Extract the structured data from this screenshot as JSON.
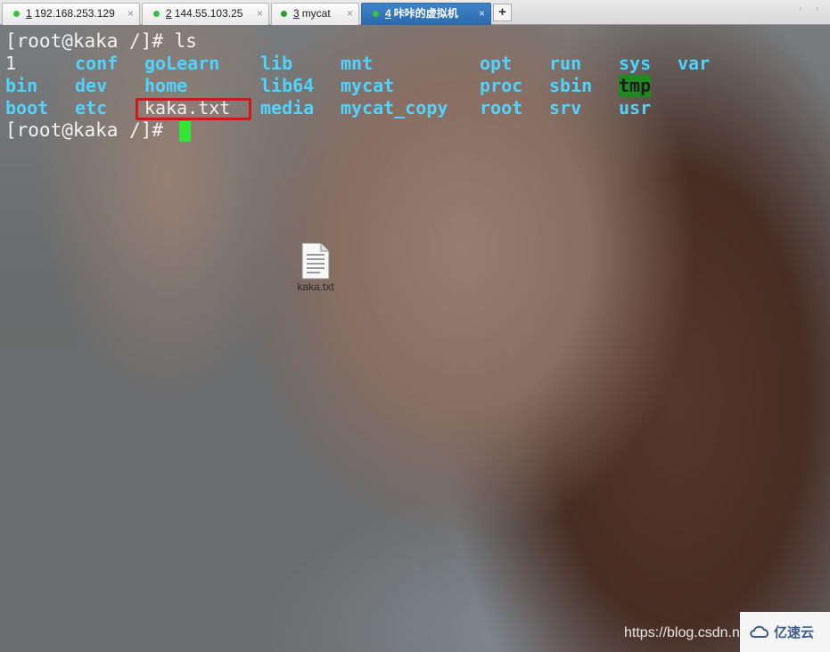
{
  "tabs": [
    {
      "num": "1",
      "label": "192.168.253.129",
      "status_color": "#3cbf3c",
      "active": false
    },
    {
      "num": "2",
      "label": "144.55.103.25",
      "status_color": "#3cbf3c",
      "active": false
    },
    {
      "num": "3",
      "label": "mycat",
      "status_color": "#2e9e2e",
      "active": false
    },
    {
      "num": "4",
      "label": "咔咔的虚拟机",
      "status_color": "#3cbf3c",
      "active": true
    }
  ],
  "tab_close_glyph": "×",
  "add_tab_label": "+",
  "nav_arrows": "‹ ›",
  "terminal": {
    "prompt1": "[root@kaka /]# ls",
    "prompt2": "[root@kaka /]# ",
    "rows": [
      [
        {
          "text": "1",
          "kind": "file"
        },
        {
          "text": "conf",
          "kind": "dir"
        },
        {
          "text": "goLearn",
          "kind": "dir"
        },
        {
          "text": "lib",
          "kind": "dir"
        },
        {
          "text": "mnt",
          "kind": "dir"
        },
        {
          "text": "opt",
          "kind": "dir"
        },
        {
          "text": "run",
          "kind": "dir"
        },
        {
          "text": "sys",
          "kind": "dir"
        },
        {
          "text": "var",
          "kind": "dir"
        }
      ],
      [
        {
          "text": "bin",
          "kind": "dir"
        },
        {
          "text": "dev",
          "kind": "dir"
        },
        {
          "text": "home",
          "kind": "dir"
        },
        {
          "text": "lib64",
          "kind": "dir"
        },
        {
          "text": "mycat",
          "kind": "dir"
        },
        {
          "text": "proc",
          "kind": "dir"
        },
        {
          "text": "sbin",
          "kind": "dir"
        },
        {
          "text": "tmp",
          "kind": "sticky"
        }
      ],
      [
        {
          "text": "boot",
          "kind": "dir"
        },
        {
          "text": "etc",
          "kind": "dir"
        },
        {
          "text": "kaka.txt",
          "kind": "file",
          "highlighted": true
        },
        {
          "text": "media",
          "kind": "dir"
        },
        {
          "text": "mycat_copy",
          "kind": "dir"
        },
        {
          "text": "root",
          "kind": "dir"
        },
        {
          "text": "srv",
          "kind": "dir"
        },
        {
          "text": "usr",
          "kind": "dir"
        }
      ]
    ],
    "colors": {
      "dir": "#4fd3ff",
      "file": "#f0f0f0",
      "sticky_bg": "#1f8a1f",
      "cursor": "#35e535",
      "highlight": "#d11717"
    }
  },
  "desktop_file": {
    "label": "kaka.txt",
    "icon": "text-file-icon"
  },
  "watermark": {
    "url": "https://blog.csdn.ne",
    "brand": "亿速云",
    "logo_icon": "cloud-logo-icon"
  }
}
